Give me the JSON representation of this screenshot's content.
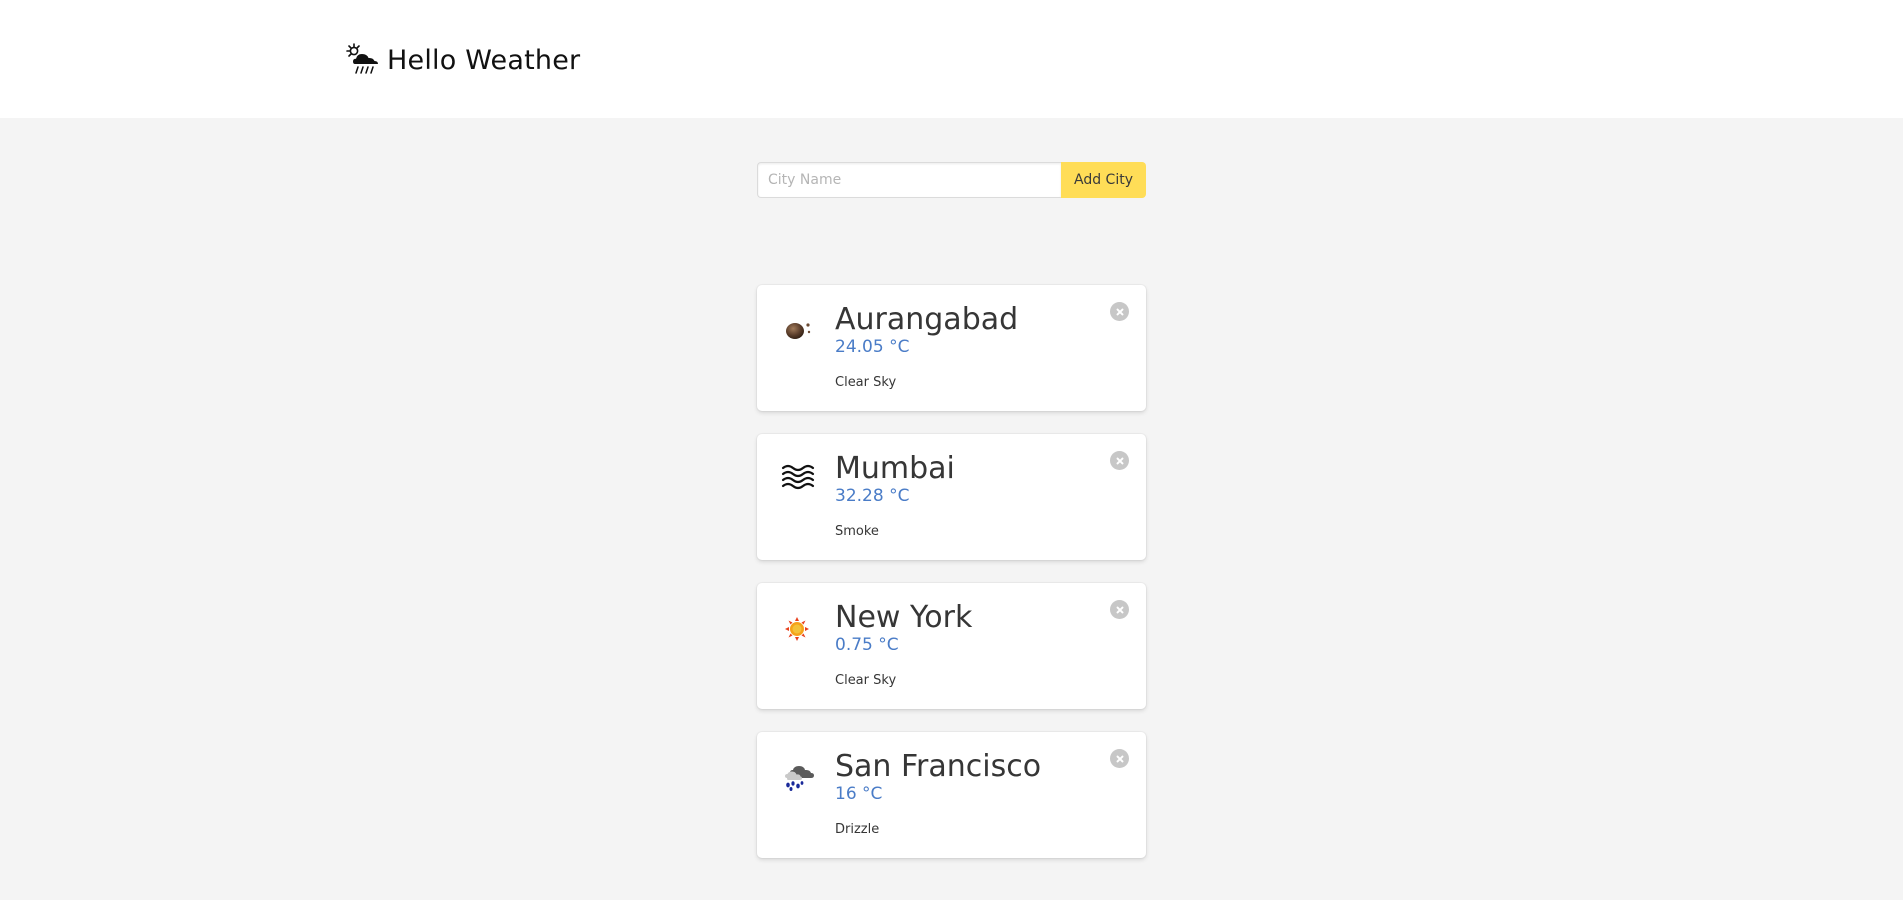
{
  "app": {
    "title": "Hello Weather",
    "icon": "sun-cloud-rain-icon"
  },
  "form": {
    "placeholder": "City Name",
    "value": "",
    "button_label": "Add City",
    "button_color": "#ffdd57"
  },
  "colors": {
    "temperature": "#4a7cc7",
    "background": "#f4f4f4",
    "card": "#ffffff"
  },
  "cities": [
    {
      "name": "Aurangabad",
      "temp": "24.05 °C",
      "desc": "Clear Sky",
      "icon": "moon-clear-night-icon"
    },
    {
      "name": "Mumbai",
      "temp": "32.28 °C",
      "desc": "Smoke",
      "icon": "smoke-waves-icon"
    },
    {
      "name": "New York",
      "temp": "0.75 °C",
      "desc": "Clear Sky",
      "icon": "sun-icon"
    },
    {
      "name": "San Francisco",
      "temp": "16 °C",
      "desc": "Drizzle",
      "icon": "drizzle-cloud-icon"
    }
  ]
}
